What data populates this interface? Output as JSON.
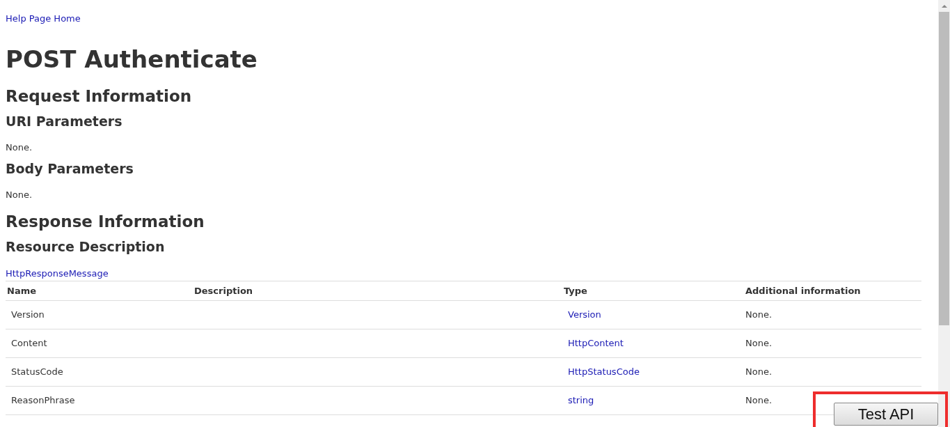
{
  "home_link": "Help Page Home",
  "title": "POST Authenticate",
  "sections": [
    {
      "kind": "h2",
      "text": "Request Information"
    },
    {
      "kind": "h3",
      "text": "URI Parameters"
    },
    {
      "kind": "p",
      "text": "None."
    },
    {
      "kind": "h3",
      "text": "Body Parameters"
    },
    {
      "kind": "p",
      "text": "None."
    },
    {
      "kind": "h2",
      "text": "Response Information"
    },
    {
      "kind": "h3",
      "text": "Resource Description"
    },
    {
      "kind": "link",
      "text": "HttpResponseMessage"
    }
  ],
  "table": {
    "columns": [
      "Name",
      "Description",
      "Type",
      "Additional information"
    ],
    "rows": [
      {
        "name": "Version",
        "description": "",
        "type": "Version",
        "info": "None."
      },
      {
        "name": "Content",
        "description": "",
        "type": "HttpContent",
        "info": "None."
      },
      {
        "name": "StatusCode",
        "description": "",
        "type": "HttpStatusCode",
        "info": "None."
      },
      {
        "name": "ReasonPhrase",
        "description": "",
        "type": "string",
        "info": "None."
      }
    ]
  },
  "test_button": {
    "label": "Test API",
    "highlighted": true
  }
}
